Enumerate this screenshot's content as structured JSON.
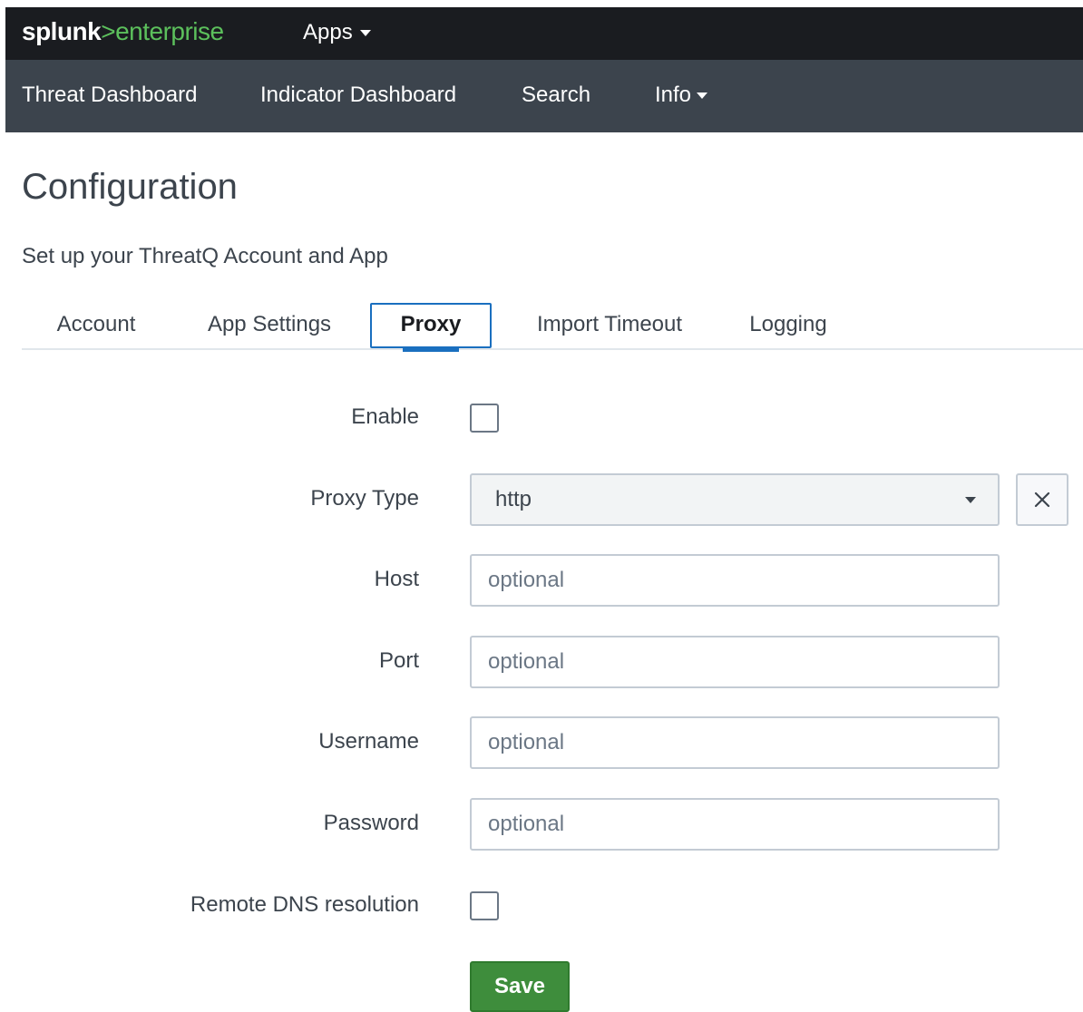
{
  "topbar": {
    "brand": "splunk",
    "separator": ">",
    "product": "enterprise",
    "apps_label": "Apps"
  },
  "appnav": {
    "items": [
      {
        "label": "Threat Dashboard"
      },
      {
        "label": "Indicator Dashboard"
      },
      {
        "label": "Search"
      },
      {
        "label": "Info"
      }
    ]
  },
  "page": {
    "title": "Configuration",
    "subtitle": "Set up your ThreatQ Account and App"
  },
  "tabs": [
    {
      "label": "Account",
      "active": false
    },
    {
      "label": "App Settings",
      "active": false
    },
    {
      "label": "Proxy",
      "active": true
    },
    {
      "label": "Import Timeout",
      "active": false
    },
    {
      "label": "Logging",
      "active": false
    }
  ],
  "form": {
    "enable": {
      "label": "Enable",
      "checked": false
    },
    "proxy_type": {
      "label": "Proxy Type",
      "value": "http"
    },
    "host": {
      "label": "Host",
      "value": "",
      "placeholder": "optional"
    },
    "port": {
      "label": "Port",
      "value": "",
      "placeholder": "optional"
    },
    "username": {
      "label": "Username",
      "value": "",
      "placeholder": "optional"
    },
    "password": {
      "label": "Password",
      "value": "",
      "placeholder": "optional"
    },
    "remote_dns": {
      "label": "Remote DNS resolution",
      "checked": false
    },
    "save_label": "Save"
  },
  "colors": {
    "topbar_bg": "#1a1c20",
    "appnav_bg": "#3c444d",
    "brand_green": "#5cc05c",
    "active_tab_blue": "#1a6fbf",
    "save_green": "#3e8d3c"
  }
}
